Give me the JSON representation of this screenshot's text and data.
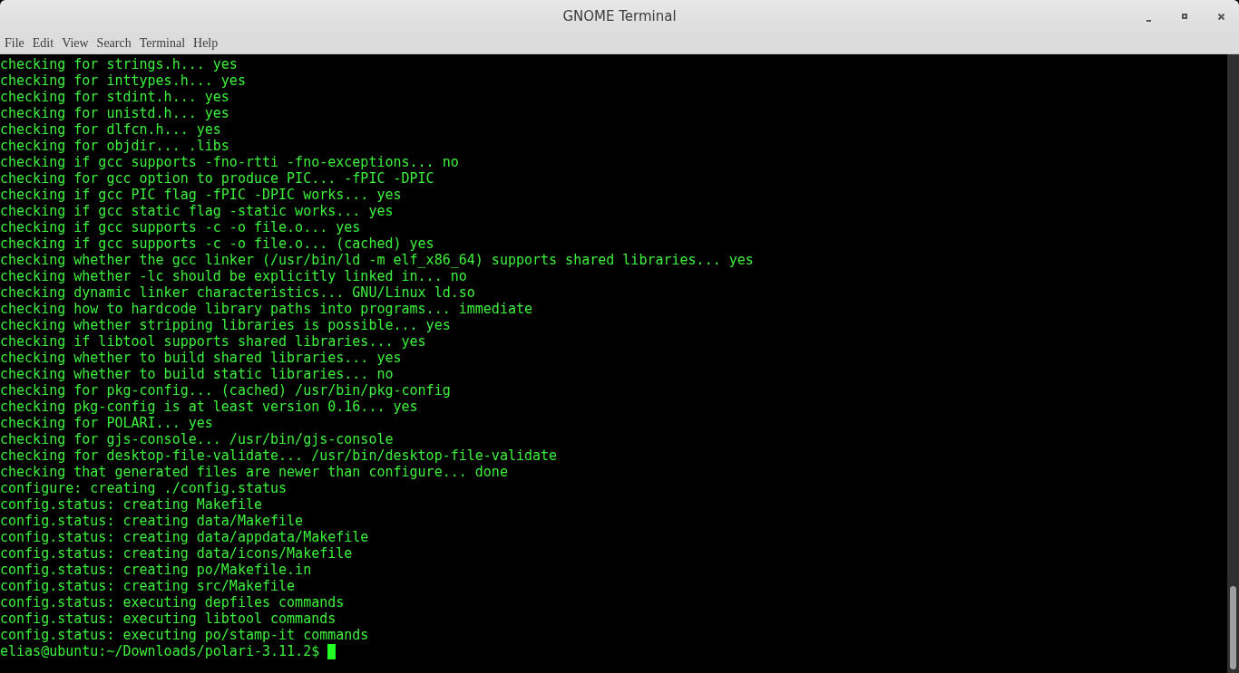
{
  "window": {
    "title": "GNOME Terminal"
  },
  "menu": [
    "File",
    "Edit",
    "View",
    "Search",
    "Terminal",
    "Help"
  ],
  "terminal": {
    "lines": [
      "checking for strings.h... yes",
      "checking for inttypes.h... yes",
      "checking for stdint.h... yes",
      "checking for unistd.h... yes",
      "checking for dlfcn.h... yes",
      "checking for objdir... .libs",
      "checking if gcc supports -fno-rtti -fno-exceptions... no",
      "checking for gcc option to produce PIC... -fPIC -DPIC",
      "checking if gcc PIC flag -fPIC -DPIC works... yes",
      "checking if gcc static flag -static works... yes",
      "checking if gcc supports -c -o file.o... yes",
      "checking if gcc supports -c -o file.o... (cached) yes",
      "checking whether the gcc linker (/usr/bin/ld -m elf_x86_64) supports shared libraries... yes",
      "checking whether -lc should be explicitly linked in... no",
      "checking dynamic linker characteristics... GNU/Linux ld.so",
      "checking how to hardcode library paths into programs... immediate",
      "checking whether stripping libraries is possible... yes",
      "checking if libtool supports shared libraries... yes",
      "checking whether to build shared libraries... yes",
      "checking whether to build static libraries... no",
      "checking for pkg-config... (cached) /usr/bin/pkg-config",
      "checking pkg-config is at least version 0.16... yes",
      "checking for POLARI... yes",
      "checking for gjs-console... /usr/bin/gjs-console",
      "checking for desktop-file-validate... /usr/bin/desktop-file-validate",
      "checking that generated files are newer than configure... done",
      "configure: creating ./config.status",
      "config.status: creating Makefile",
      "config.status: creating data/Makefile",
      "config.status: creating data/appdata/Makefile",
      "config.status: creating data/icons/Makefile",
      "config.status: creating po/Makefile.in",
      "config.status: creating src/Makefile",
      "config.status: executing depfiles commands",
      "config.status: executing libtool commands",
      "config.status: executing po/stamp-it commands"
    ],
    "prompt": "elias@ubuntu:~/Downloads/polari-3.11.2$"
  }
}
